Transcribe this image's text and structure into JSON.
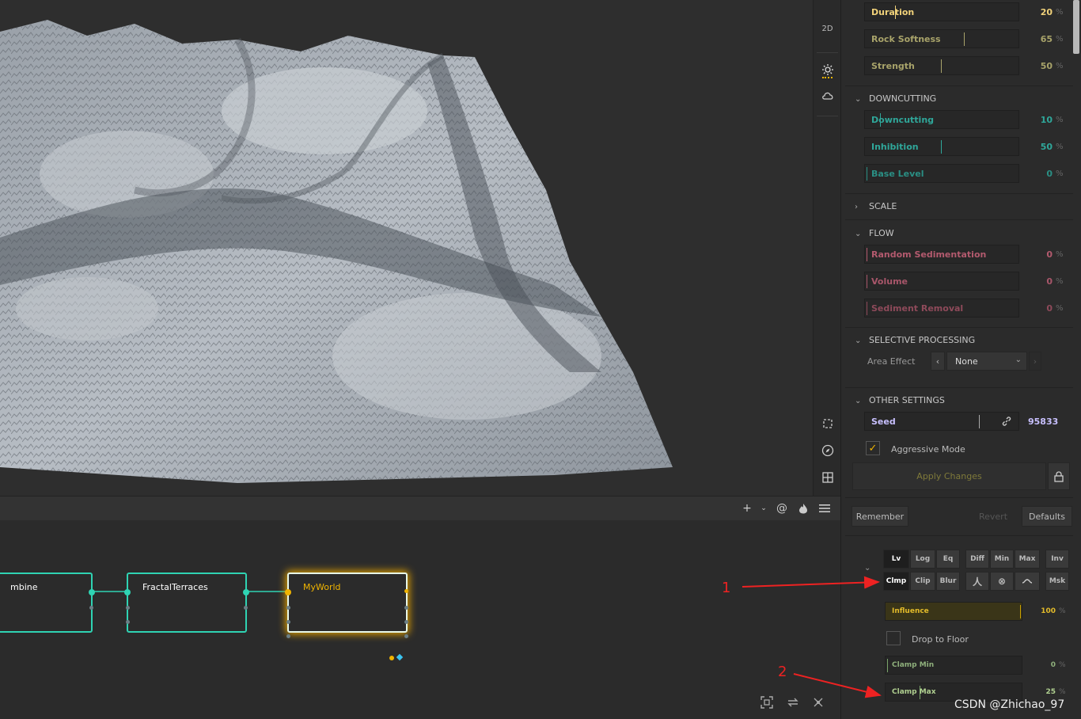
{
  "viewport_toolbar": {
    "mode_2d": "2D",
    "icons": [
      "sun-icon",
      "cloud-icon",
      "frame-icon",
      "compass-icon",
      "grid-icon"
    ]
  },
  "graph_toolbar": {
    "icons": [
      "plus-icon",
      "chevron-down-icon",
      "at-icon",
      "flame-icon",
      "menu-icon"
    ]
  },
  "nodes": [
    {
      "title": "mbine"
    },
    {
      "title": "FractalTerraces"
    },
    {
      "title": "MyWorld"
    }
  ],
  "panel": {
    "top_sliders": [
      {
        "label": "Duration",
        "value": "20",
        "unit": "%",
        "color": "#f1d27a",
        "fraction": 0.2
      },
      {
        "label": "Rock Softness",
        "value": "65",
        "unit": "%",
        "color": "#a8a36a",
        "fraction": 0.65
      },
      {
        "label": "Strength",
        "value": "50",
        "unit": "%",
        "color": "#a8a36a",
        "fraction": 0.5
      }
    ],
    "downcutting": {
      "title": "DOWNCUTTING",
      "sliders": [
        {
          "label": "Downcutting",
          "value": "10",
          "unit": "%",
          "color": "#2fa79a",
          "fraction": 0.1
        },
        {
          "label": "Inhibition",
          "value": "50",
          "unit": "%",
          "color": "#2fa79a",
          "fraction": 0.5
        },
        {
          "label": "Base Level",
          "value": "0",
          "unit": "%",
          "color": "#2a8f84",
          "fraction": 0.0
        }
      ]
    },
    "scale": {
      "title": "SCALE"
    },
    "flow": {
      "title": "FLOW",
      "sliders": [
        {
          "label": "Random Sedimentation",
          "value": "0",
          "unit": "%",
          "color": "#b35a6e",
          "fraction": 0.0
        },
        {
          "label": "Volume",
          "value": "0",
          "unit": "%",
          "color": "#a8566a",
          "fraction": 0.0
        },
        {
          "label": "Sediment Removal",
          "value": "0",
          "unit": "%",
          "color": "#8e4a5a",
          "fraction": 0.0
        }
      ]
    },
    "selective": {
      "title": "SELECTIVE PROCESSING",
      "area_effect_label": "Area Effect",
      "area_effect_value": "None"
    },
    "other": {
      "title": "OTHER SETTINGS",
      "seed_label": "Seed",
      "seed_value": "95833",
      "aggressive_label": "Aggressive Mode",
      "aggressive_checked": true,
      "apply_label": "Apply Changes"
    },
    "actions": {
      "remember": "Remember",
      "revert": "Revert",
      "defaults": "Defaults"
    },
    "modes_row1": [
      "Lv",
      "Log",
      "Eq",
      "Diff",
      "Min",
      "Max",
      "Inv"
    ],
    "modes_row2": [
      "Clmp",
      "Clip",
      "Blur",
      "Msk"
    ],
    "modes_row2_icons": [
      "lambda-icon",
      "circle-x-icon",
      "wave-icon"
    ],
    "influence": {
      "label": "Influence",
      "value": "100",
      "unit": "%",
      "fraction": 1.0
    },
    "drop_to_floor": "Drop to Floor",
    "clamp_min": {
      "label": "Clamp Min",
      "value": "0",
      "unit": "%",
      "fraction": 0.0
    },
    "clamp_max": {
      "label": "Clamp Max",
      "value": "25",
      "unit": "%",
      "fraction": 0.25
    }
  },
  "annotations": {
    "one": "1",
    "two": "2"
  },
  "watermark": "CSDN @Zhichao_97"
}
